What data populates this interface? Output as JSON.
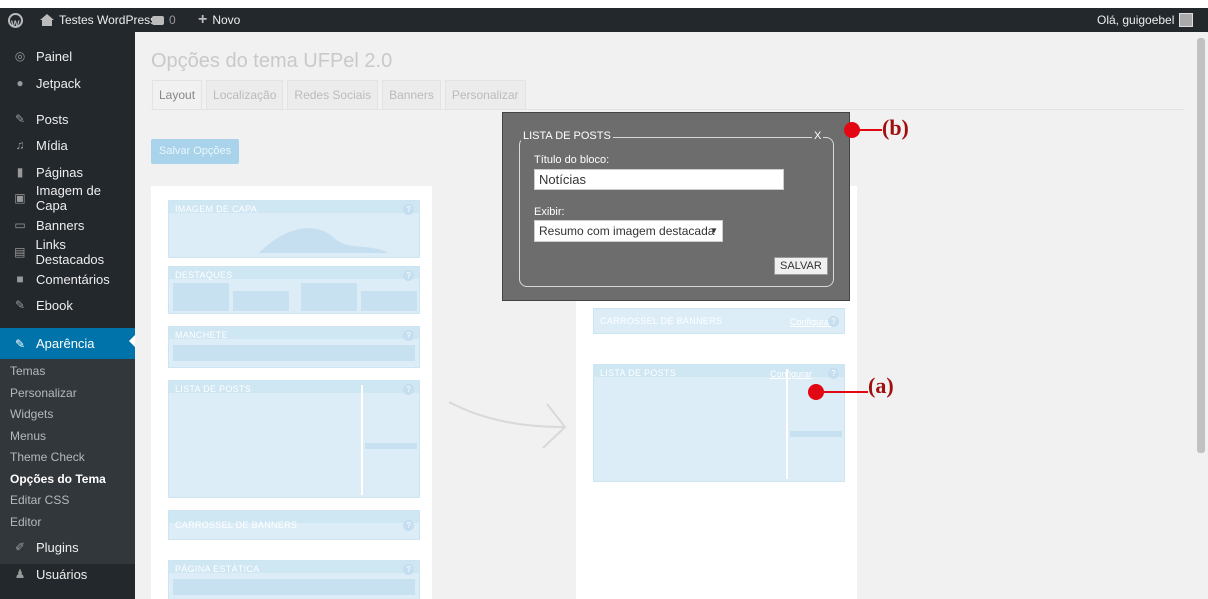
{
  "adminbar": {
    "site_name": "Testes WordPress",
    "comments_count": "0",
    "new_label": "Novo",
    "greeting": "Olá, guigoebel"
  },
  "sidebar": {
    "items": [
      {
        "label": "Painel",
        "icon": "dashboard-icon"
      },
      {
        "label": "Jetpack",
        "icon": "jetpack-icon"
      },
      {
        "label": "Posts",
        "icon": "pin-icon"
      },
      {
        "label": "Mídia",
        "icon": "media-icon"
      },
      {
        "label": "Páginas",
        "icon": "pages-icon"
      },
      {
        "label": "Imagem de Capa",
        "icon": "image-icon"
      },
      {
        "label": "Banners",
        "icon": "banner-icon"
      },
      {
        "label": "Links Destacados",
        "icon": "links-icon"
      },
      {
        "label": "Comentários",
        "icon": "comment-icon"
      },
      {
        "label": "Ebook",
        "icon": "pin-icon"
      },
      {
        "label": "Aparência",
        "icon": "appearance-icon"
      },
      {
        "label": "Plugins",
        "icon": "plugin-icon"
      },
      {
        "label": "Usuários",
        "icon": "users-icon"
      }
    ],
    "submenu": [
      "Temas",
      "Personalizar",
      "Widgets",
      "Menus",
      "Theme Check",
      "Opções do Tema",
      "Editar CSS",
      "Editor"
    ],
    "current_submenu": "Opções do Tema"
  },
  "main": {
    "title": "Opções do tema UFPel 2.0",
    "tabs": [
      "Layout",
      "Localização",
      "Redes Sociais",
      "Banners",
      "Personalizar"
    ],
    "active_tab": "Layout",
    "save_button": "Salvar Opções",
    "left_blocks": [
      "IMAGEM DE CAPA",
      "DESTAQUES",
      "MANCHETE",
      "LISTA DE POSTS",
      "CARROSSEL DE BANNERS",
      "PÁGINA ESTÁTICA"
    ],
    "right_blocks": [
      "CARROSSEL DE BANNERS",
      "LISTA DE POSTS"
    ],
    "configure_label": "Configurar",
    "help_glyph": "?"
  },
  "modal": {
    "legend": "LISTA DE POSTS",
    "close": "X",
    "title_label": "Título do bloco:",
    "title_value": "Notícias",
    "show_label": "Exibir:",
    "show_value": "Resumo com imagem destacada",
    "save": "SALVAR"
  },
  "annotations": {
    "a": "(a)",
    "b": "(b)"
  },
  "colors": {
    "adminbar_bg": "#23282d",
    "accent": "#0073aa",
    "annotation": "#e30613",
    "modal_bg": "#6d6d6d"
  }
}
